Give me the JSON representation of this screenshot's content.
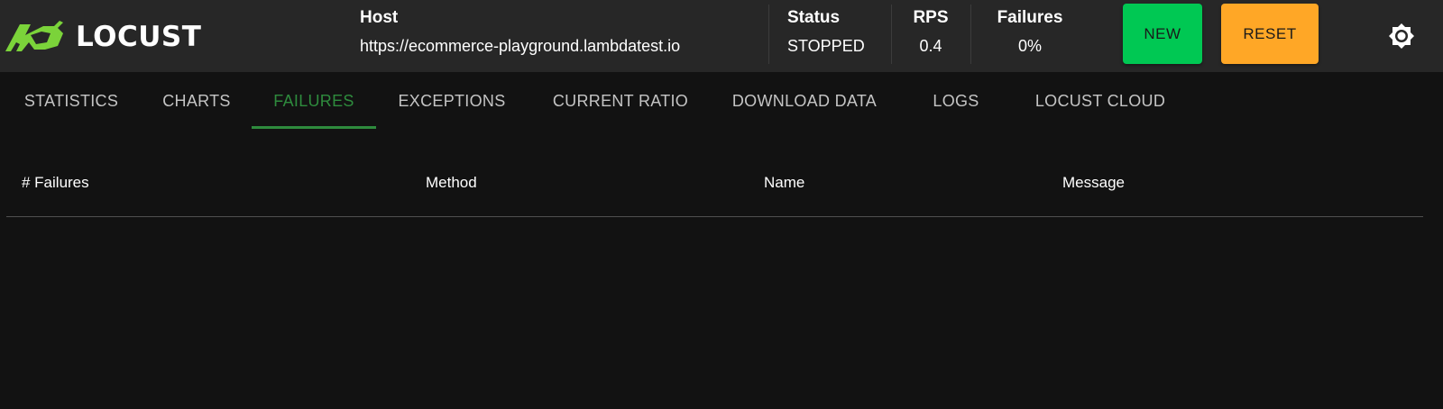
{
  "app": {
    "name": "LOCUST",
    "logo_color": "#7bd33a"
  },
  "header": {
    "host_label": "Host",
    "host_value": "https://ecommerce-playground.lambdatest.io",
    "status_label": "Status",
    "status_value": "STOPPED",
    "rps_label": "RPS",
    "rps_value": "0.4",
    "failures_label": "Failures",
    "failures_value": "0%",
    "new_button": "NEW",
    "reset_button": "RESET",
    "new_color": "#00c853",
    "reset_color": "#ffa726",
    "theme_icon": "sun-icon"
  },
  "tabs": [
    {
      "label": "STATISTICS"
    },
    {
      "label": "CHARTS"
    },
    {
      "label": "FAILURES"
    },
    {
      "label": "EXCEPTIONS"
    },
    {
      "label": "CURRENT RATIO"
    },
    {
      "label": "DOWNLOAD DATA"
    },
    {
      "label": "LOGS"
    },
    {
      "label": "LOCUST CLOUD"
    }
  ],
  "active_tab": "FAILURES",
  "accent_color": "#2e8b3d",
  "failures_table": {
    "columns": [
      "# Failures",
      "Method",
      "Name",
      "Message"
    ],
    "rows": []
  }
}
